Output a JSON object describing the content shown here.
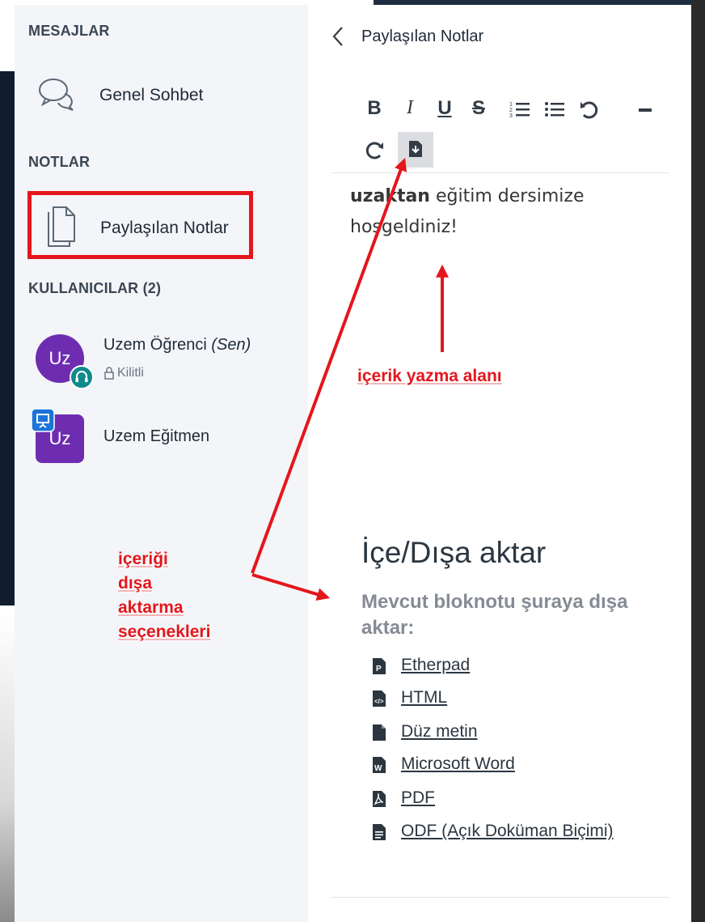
{
  "sidebar": {
    "messages_title": "MESAJLAR",
    "chat_label": "Genel Sohbet",
    "notes_title": "NOTLAR",
    "shared_notes_label": "Paylaşılan Notlar",
    "users_title": "KULLANICILAR (2)",
    "users": [
      {
        "initials": "Uz",
        "name": "Uzem Öğrenci",
        "you_tag": "(Sen)",
        "status": "Kilitli"
      },
      {
        "initials": "Uz",
        "name": "Uzem Eğitmen"
      }
    ]
  },
  "panel": {
    "title": "Paylaşılan Notlar",
    "toolbar": {
      "bold": "B",
      "italic": "I",
      "underline": "U",
      "strike": "S",
      "ordered_list": "☰",
      "unordered_list": "☰",
      "undo": "↶",
      "redo": "↻",
      "minimize": "−"
    },
    "editor": {
      "bold_word": "uzaktan",
      "text": " eğitim dersimize hoşgeldiniz!"
    },
    "export": {
      "title": "İçe/Dışa aktar",
      "subtitle": "Mevcut bloknotu şuraya dışa aktar:",
      "options": [
        "Etherpad",
        "HTML",
        "Düz metin",
        "Microsoft Word",
        "PDF",
        "ODF (Açık Doküman Biçimi)"
      ]
    }
  },
  "annotations": {
    "content_area": "içerik yazma alanı",
    "export_options": [
      "içeriği",
      "dışa",
      "aktarma",
      "seçenekleri"
    ]
  },
  "colors": {
    "accent_red": "#e4161c",
    "avatar_purple": "#6e2db1",
    "status_teal": "#0f8a8c",
    "presenter_blue": "#1c74d8"
  }
}
